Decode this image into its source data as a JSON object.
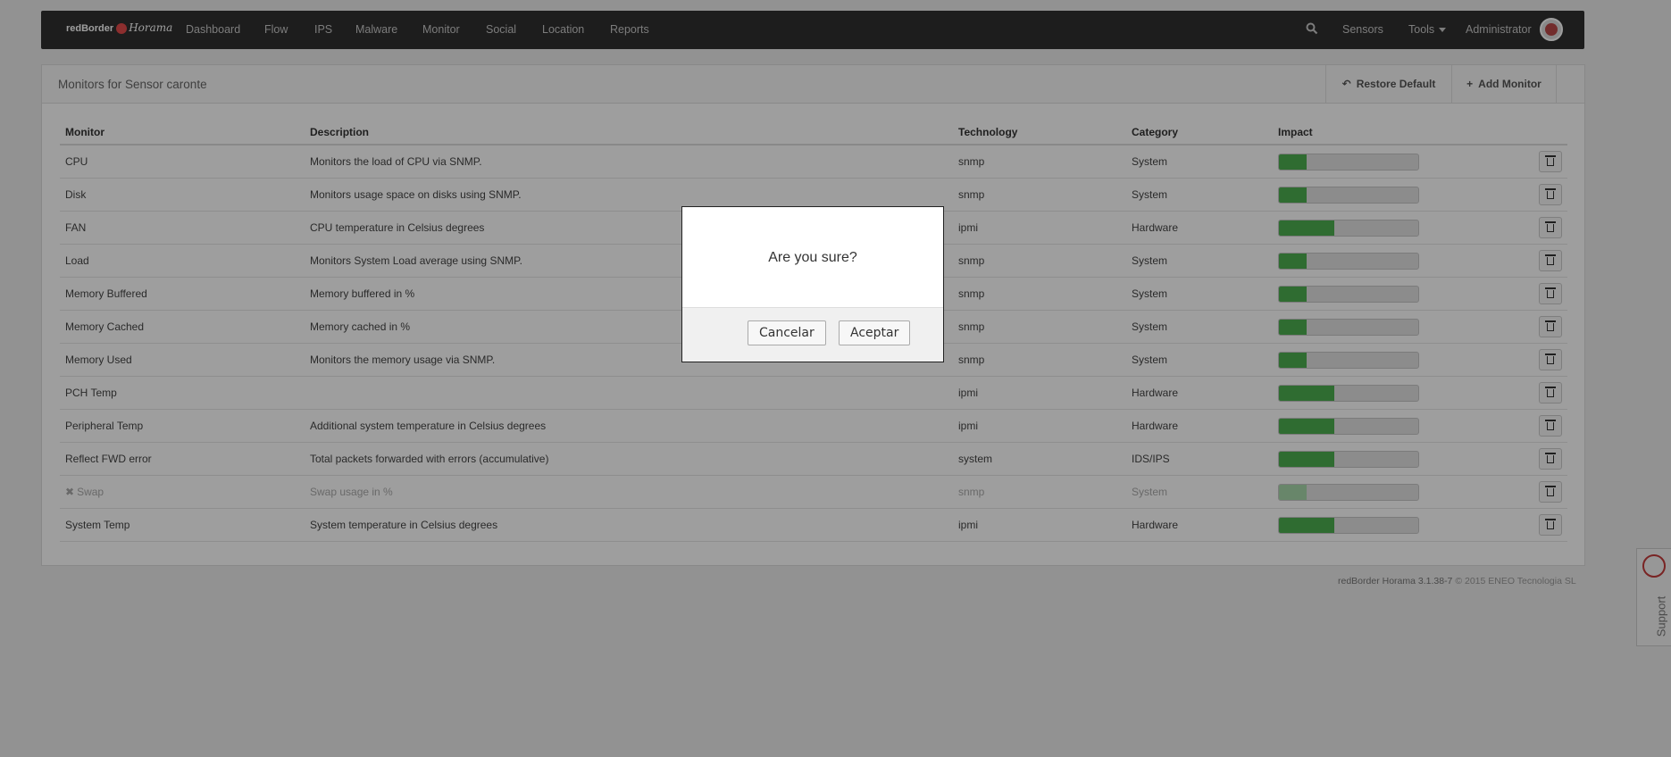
{
  "navbar": {
    "brand": "redBorder",
    "brand_script": "Horama",
    "links": [
      "Dashboard",
      "Flow",
      "IPS",
      "Malware",
      "Monitor",
      "Social",
      "Location",
      "Reports"
    ],
    "sensors": "Sensors",
    "tools": "Tools",
    "user": "Administrator"
  },
  "panel": {
    "title": "Monitors for Sensor caronte",
    "restore_label": "Restore Default",
    "add_label": "Add Monitor"
  },
  "table": {
    "headers": [
      "Monitor",
      "Description",
      "Technology",
      "Category",
      "Impact"
    ],
    "rows": [
      {
        "monitor": "CPU",
        "description": "Monitors the load of CPU via SNMP.",
        "technology": "snmp",
        "category": "System",
        "impact": 0.2
      },
      {
        "monitor": "Disk",
        "description": "Monitors usage space on disks using SNMP.",
        "technology": "snmp",
        "category": "System",
        "impact": 0.2
      },
      {
        "monitor": "FAN",
        "description": "CPU temperature in Celsius degrees",
        "technology": "ipmi",
        "category": "Hardware",
        "impact": 0.4
      },
      {
        "monitor": "Load",
        "description": "Monitors System Load average using SNMP.",
        "technology": "snmp",
        "category": "System",
        "impact": 0.2
      },
      {
        "monitor": "Memory Buffered",
        "description": "Memory buffered in %",
        "technology": "snmp",
        "category": "System",
        "impact": 0.2
      },
      {
        "monitor": "Memory Cached",
        "description": "Memory cached in %",
        "technology": "snmp",
        "category": "System",
        "impact": 0.2
      },
      {
        "monitor": "Memory Used",
        "description": "Monitors the memory usage via SNMP.",
        "technology": "snmp",
        "category": "System",
        "impact": 0.2
      },
      {
        "monitor": "PCH Temp",
        "description": "",
        "technology": "ipmi",
        "category": "Hardware",
        "impact": 0.4
      },
      {
        "monitor": "Peripheral Temp",
        "description": "Additional system temperature in Celsius degrees",
        "technology": "ipmi",
        "category": "Hardware",
        "impact": 0.4
      },
      {
        "monitor": "Reflect FWD error",
        "description": "Total packets forwarded with errors (accumulative)",
        "technology": "system",
        "category": "IDS/IPS",
        "impact": 0.4
      },
      {
        "monitor": "Swap",
        "description": "Swap usage in %",
        "technology": "snmp",
        "category": "System",
        "impact": 0.2,
        "disabled": true
      },
      {
        "monitor": "System Temp",
        "description": "System temperature in Celsius degrees",
        "technology": "ipmi",
        "category": "Hardware",
        "impact": 0.4
      }
    ]
  },
  "footer": {
    "version": "redBorder Horama 3.1.38-7",
    "copyright": "© 2015 ENEO Tecnologia SL"
  },
  "support": "Support",
  "dialog": {
    "message": "Are you sure?",
    "cancel": "Cancelar",
    "accept": "Aceptar"
  },
  "colors": {
    "navbar": "#2f2f2f",
    "impact_fill": "#4caf50"
  }
}
